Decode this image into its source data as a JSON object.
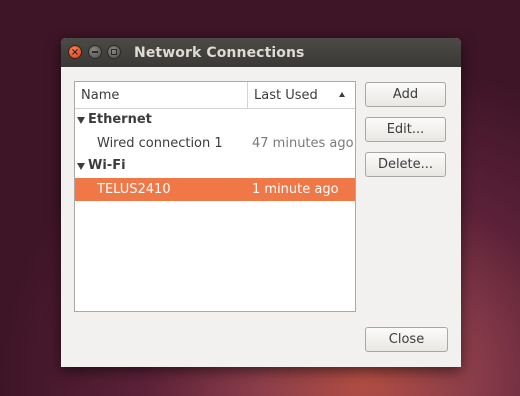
{
  "window": {
    "title": "Network Connections"
  },
  "list": {
    "columns": {
      "name": "Name",
      "last_used": "Last Used"
    },
    "groups": [
      {
        "label": "Ethernet",
        "connections": [
          {
            "name": "Wired connection 1",
            "last_used": "47 minutes ago",
            "selected": false
          }
        ]
      },
      {
        "label": "Wi-Fi",
        "connections": [
          {
            "name": "TELUS2410",
            "last_used": "1 minute ago",
            "selected": true
          }
        ]
      }
    ]
  },
  "buttons": {
    "add": "Add",
    "edit": "Edit...",
    "delete": "Delete...",
    "close": "Close"
  },
  "colors": {
    "selection": "#f07746",
    "titlebar": "#3c3b37",
    "close_button": "#e95420"
  },
  "icons": {
    "titlebar_close": "close-icon",
    "titlebar_minimize": "minimize-icon",
    "titlebar_maximize": "maximize-icon",
    "sort": "sort-ascending-icon",
    "group_expander": "expander-down-icon"
  }
}
